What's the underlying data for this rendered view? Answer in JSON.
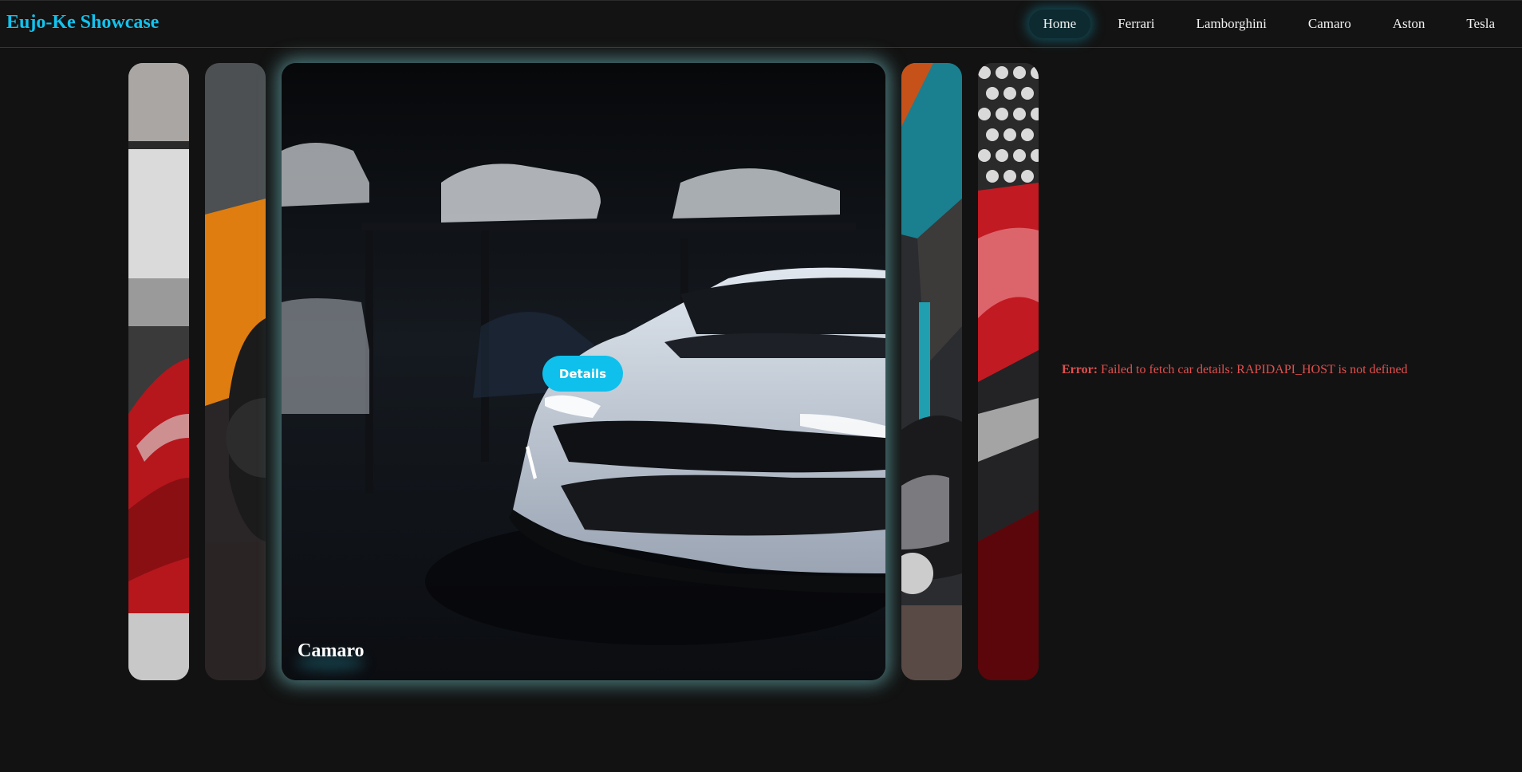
{
  "brand": "Eujo-Ke Showcase",
  "nav": [
    {
      "label": "Home",
      "active": true
    },
    {
      "label": "Ferrari",
      "active": false
    },
    {
      "label": "Lamborghini",
      "active": false
    },
    {
      "label": "Camaro",
      "active": false
    },
    {
      "label": "Aston",
      "active": false
    },
    {
      "label": "Tesla",
      "active": false
    }
  ],
  "carousel": {
    "active_title": "Camaro",
    "details_label": "Details"
  },
  "error": {
    "label": "Error:",
    "message": "Failed to fetch car details: RAPIDAPI_HOST is not defined"
  },
  "colors": {
    "accent": "#13c2ee",
    "error": "#e2504f",
    "background": "#121212"
  }
}
